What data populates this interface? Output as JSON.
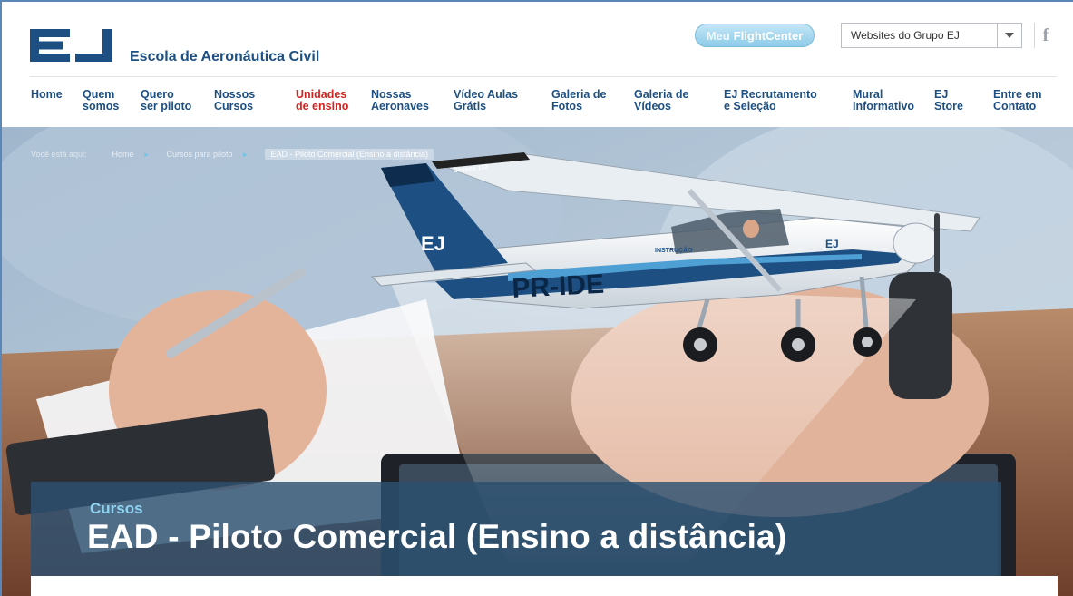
{
  "brand": {
    "logo_text": "EJ",
    "name": "Escola de Aeronáutica Civil",
    "brand_color": "#1d4f82"
  },
  "top_bar": {
    "flightcenter_light": "Meu",
    "flightcenter_strong": "FlightCenter",
    "websites_select": "Websites do Grupo EJ",
    "facebook_icon": "f"
  },
  "nav": {
    "items": [
      {
        "line1": "Home",
        "line2": ""
      },
      {
        "line1": "Quem",
        "line2": "somos"
      },
      {
        "line1": "Quero",
        "line2": "ser piloto"
      },
      {
        "line1": "Nossos",
        "line2": "Cursos"
      },
      {
        "line1": "Unidades",
        "line2": "de ensino"
      },
      {
        "line1": "Nossas",
        "line2": "Aeronaves"
      },
      {
        "line1": "Vídeo Aulas",
        "line2": "Grátis"
      },
      {
        "line1": "Galeria de",
        "line2": "Fotos"
      },
      {
        "line1": "Galeria de",
        "line2": "Vídeos"
      },
      {
        "line1": "EJ Recrutamento",
        "line2": "e Seleção"
      },
      {
        "line1": "Mural",
        "line2": "Informativo"
      },
      {
        "line1": "EJ",
        "line2": "Store"
      },
      {
        "line1": "Entre em",
        "line2": "Contato"
      }
    ],
    "active_color": "#d2231f"
  },
  "breadcrumb": {
    "lead": "Você está aqui:",
    "items": [
      "Home",
      "Cursos para piloto",
      "EAD - Piloto Comercial (Ensino a distância)"
    ],
    "separator": "►"
  },
  "hero": {
    "aircraft_registration": "PR-IDE",
    "tail_logo": "EJ",
    "cabin_label": "INSTRUÇÃO",
    "wing_label": "Cessna 152",
    "engine_logo": "EJ"
  },
  "page_title": {
    "category": "Cursos",
    "title": "EAD - Piloto Comercial (Ensino a distância)"
  }
}
